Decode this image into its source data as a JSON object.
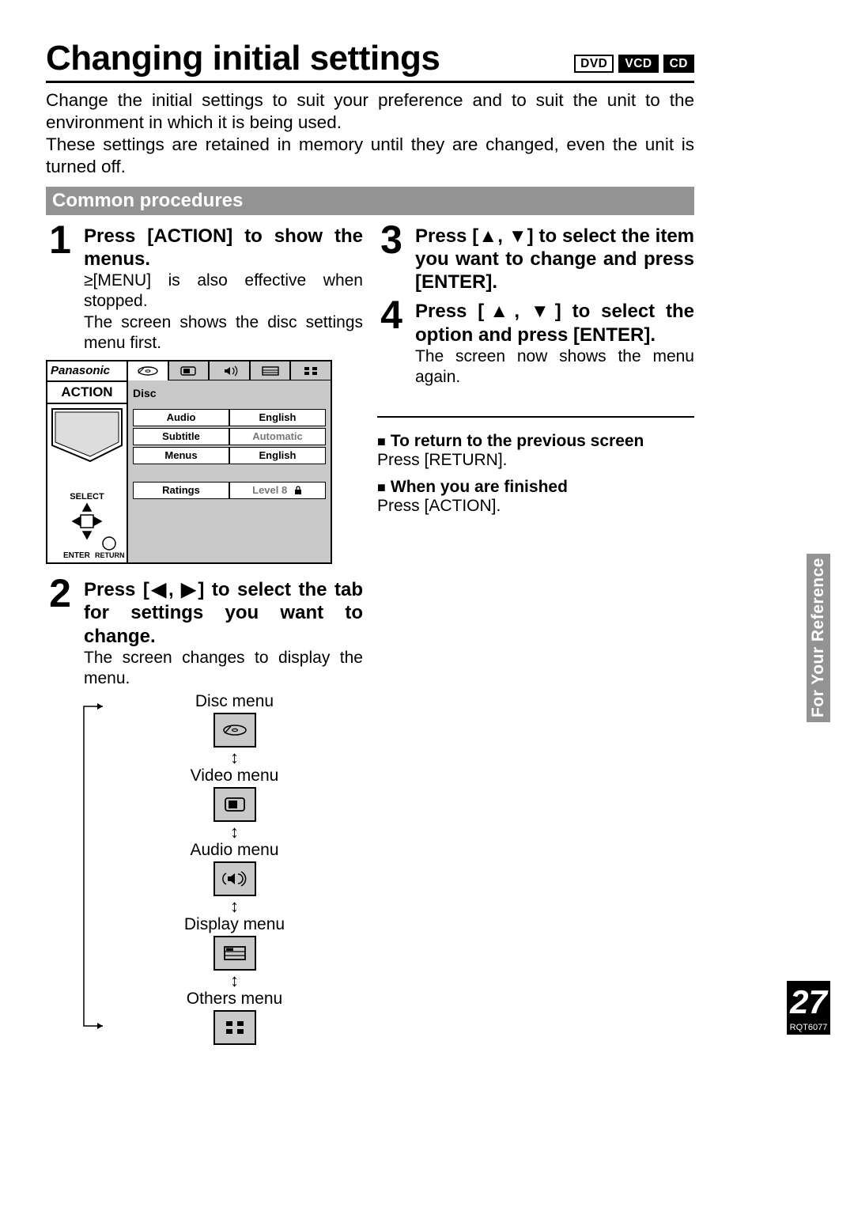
{
  "title": "Changing initial settings",
  "badges": {
    "dvd": "DVD",
    "vcd": "VCD",
    "cd": "CD"
  },
  "intro": {
    "p1": "Change the initial settings to suit your preference and to suit the unit to the environment in which it is being used.",
    "p2": "These settings are retained in memory until they are changed, even the unit is turned off."
  },
  "section_bar": "Common procedures",
  "steps": {
    "one": {
      "num": "1",
      "title": "Press [ACTION] to show the menus.",
      "sub_bullet": "≥[MENU] is also effective when stopped.",
      "sub_line": "The screen shows the disc settings menu first."
    },
    "two": {
      "num": "2",
      "title": "Press [◀, ▶] to select the tab for settings you want to change.",
      "sub": "The screen changes to display the menu."
    },
    "three": {
      "num": "3",
      "title": "Press [▲, ▼] to select the item you want to change and press [ENTER]."
    },
    "four": {
      "num": "4",
      "title": "Press [▲, ▼] to select the option and press [ENTER].",
      "sub": "The screen now shows the menu again."
    }
  },
  "osd": {
    "brand": "Panasonic",
    "action": "ACTION",
    "select": "SELECT",
    "enter": "ENTER",
    "return": "RETURN",
    "tab_label": "Disc",
    "rows": [
      {
        "label": "Audio",
        "value": "English"
      },
      {
        "label": "Subtitle",
        "value": "Automatic"
      },
      {
        "label": "Menus",
        "value": "English"
      }
    ],
    "ratings_row": {
      "label": "Ratings",
      "value": "Level 8"
    }
  },
  "cycle": {
    "items": [
      "Disc menu",
      "Video menu",
      "Audio menu",
      "Display menu",
      "Others menu"
    ],
    "updown": "↕"
  },
  "notes": {
    "return_title": "To return to the previous screen",
    "return_body": "Press [RETURN].",
    "finish_title": "When you are finished",
    "finish_body": "Press [ACTION]."
  },
  "side_tab": "For Your Reference",
  "pagenum": "27",
  "pagecode": "RQT6077"
}
